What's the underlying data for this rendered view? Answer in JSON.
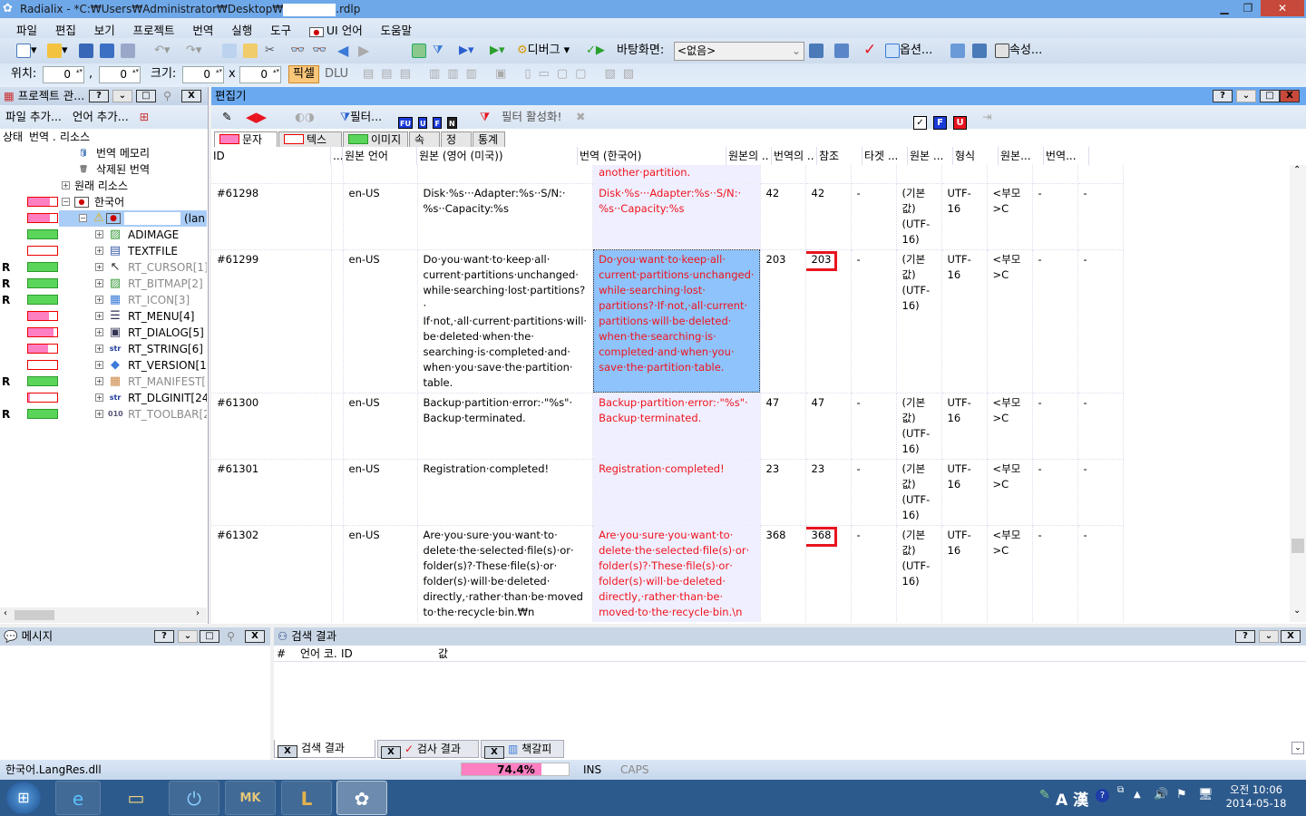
{
  "window": {
    "app_title_prefix": "Radialix - *C:₩Users₩Administrator₩Desktop₩",
    "app_title_suffix": ".rdlp",
    "minimize": "▁",
    "restore": "❐",
    "close": "✕",
    "close_color": "#c7493b"
  },
  "menu": [
    "파일",
    "편집",
    "보기",
    "프로젝트",
    "번역",
    "실행",
    "도구",
    "UI 언어",
    "도움말"
  ],
  "toolbar": {
    "debug_label": "디버그",
    "desktop_label": "바탕화면:",
    "desktop_value": "<없음>",
    "options_label": "옵션...",
    "properties_label": "속성...",
    "position_label": "위치:",
    "pos_x": "0",
    "pos_y": "0",
    "comma": ",",
    "size_label": "크기:",
    "size_w": "0",
    "size_h": "0",
    "times": "x",
    "pixel_label": "픽셀",
    "dlu_label": "DLU"
  },
  "project": {
    "title": "프로젝트 관...",
    "add_file": "파일 추가...",
    "add_language": "언어 추가...",
    "col_status": "상태",
    "col_translation": "번역 .",
    "col_resources": "리소스",
    "tree": [
      {
        "label": "번역 메모리",
        "icon": "database-icon",
        "status": "",
        "bar": "none",
        "fill": 0,
        "grey": false,
        "level": 0,
        "expander": ""
      },
      {
        "label": "삭제된 번역",
        "icon": "trash-icon",
        "status": "",
        "bar": "none",
        "fill": 0,
        "grey": false,
        "level": 0,
        "expander": ""
      },
      {
        "label": "원래 리소스",
        "icon": "",
        "status": "",
        "bar": "none",
        "fill": 0,
        "grey": false,
        "level": -1,
        "expander": "+"
      },
      {
        "label": "한국어",
        "icon": "korea-flag-icon",
        "status": "",
        "bar": "pink",
        "fill": 0.75,
        "grey": false,
        "level": -1,
        "expander": "-"
      },
      {
        "label": "(lan",
        "icon": "warning-flag-icon",
        "status": "",
        "bar": "pink",
        "fill": 0.75,
        "grey": false,
        "level": 1,
        "expander": "-",
        "selected": true
      },
      {
        "label": "ADIMAGE",
        "icon": "image-icon",
        "status": "",
        "bar": "green",
        "fill": 1,
        "grey": false,
        "level": 2,
        "expander": "+"
      },
      {
        "label": "TEXTFILE",
        "icon": "textfile-icon",
        "status": "",
        "bar": "pink",
        "fill": 0,
        "grey": false,
        "level": 2,
        "expander": "+"
      },
      {
        "label": "RT_CURSOR[1]",
        "icon": "cursor-icon",
        "status": "R",
        "bar": "green",
        "fill": 1,
        "grey": true,
        "level": 2,
        "expander": "+"
      },
      {
        "label": "RT_BITMAP[2]",
        "icon": "bitmap-icon",
        "status": "R",
        "bar": "green",
        "fill": 1,
        "grey": true,
        "level": 2,
        "expander": "+"
      },
      {
        "label": "RT_ICON[3]",
        "icon": "icon-resource-icon",
        "status": "R",
        "bar": "green",
        "fill": 1,
        "grey": true,
        "level": 2,
        "expander": "+"
      },
      {
        "label": "RT_MENU[4]",
        "icon": "menu-icon",
        "status": "",
        "bar": "pink",
        "fill": 0.72,
        "grey": false,
        "level": 2,
        "expander": "+"
      },
      {
        "label": "RT_DIALOG[5]",
        "icon": "dialog-icon",
        "status": "",
        "bar": "pink",
        "fill": 0.88,
        "grey": false,
        "level": 2,
        "expander": "+"
      },
      {
        "label": "RT_STRING[6]",
        "icon": "string-icon",
        "status": "",
        "bar": "pink",
        "fill": 0.68,
        "grey": false,
        "level": 2,
        "expander": "+"
      },
      {
        "label": "RT_VERSION[1",
        "icon": "version-icon",
        "status": "",
        "bar": "pink",
        "fill": 0,
        "grey": false,
        "level": 2,
        "expander": "+"
      },
      {
        "label": "RT_MANIFEST[",
        "icon": "manifest-icon",
        "status": "R",
        "bar": "green",
        "fill": 1,
        "grey": true,
        "level": 2,
        "expander": "+"
      },
      {
        "label": "RT_DLGINIT[24",
        "icon": "string-icon",
        "status": "",
        "bar": "pink",
        "fill": 0.05,
        "grey": false,
        "level": 2,
        "expander": "+"
      },
      {
        "label": "RT_TOOLBAR[2",
        "icon": "toolbar-icon",
        "status": "R",
        "bar": "green",
        "fill": 1,
        "grey": true,
        "level": 2,
        "expander": "+"
      }
    ]
  },
  "editor": {
    "title": "편집기",
    "filter_label": "필터...",
    "filter_activate": "필터 활성화!",
    "filter_badges": [
      "FU",
      "U",
      "F",
      "N"
    ],
    "right_badges": [
      "✓",
      "F",
      "U"
    ],
    "tabs": [
      {
        "label": "문자열",
        "swatch": "pink"
      },
      {
        "label": "텍스트",
        "swatch": "outline"
      },
      {
        "label": "이미지",
        "swatch": "green"
      },
      {
        "label": "속성",
        "swatch": ""
      },
      {
        "label": "정보",
        "swatch": ""
      },
      {
        "label": "통계",
        "swatch": ""
      }
    ],
    "columns": [
      "ID",
      "...",
      "원본 언어",
      "원본 (영어 (미국))",
      "번역 (한국어)",
      "원본의 ..",
      "번역의 ..",
      "참조",
      "타겟 ...",
      "원본 ...",
      "형식",
      "원본...",
      "번역..."
    ],
    "rows": [
      {
        "id": "",
        "lang": "",
        "source": "",
        "translation": "another·partition.",
        "src_len": "",
        "tr_len": "",
        "ref": "",
        "target": "",
        "src_enc": "",
        "format": "",
        "c11": "",
        "c12": ""
      },
      {
        "id": "#61298",
        "lang": "en-US",
        "source": "Disk·%s···Adapter:%s··S/N:·\n%s··Capacity:%s",
        "translation": "Disk·%s···Adapter:%s··S/N:·\n%s··Capacity:%s",
        "src_len": "42",
        "tr_len": "42",
        "ref": "-",
        "target": "(기본값)\n(UTF-16)",
        "src_enc": "UTF-16",
        "format": "<부모>C",
        "c11": "-",
        "c12": "-"
      },
      {
        "id": "#61299",
        "lang": "en-US",
        "source": "Do·you·want·to·keep·all·\ncurrent·partitions·unchanged·\nwhile·searching·lost·partitions?·\nIf·not,·all·current·partitions·will·\nbe·deleted·when·the·\nsearching·is·completed·and·\nwhen·you·save·the·partition·\ntable.",
        "translation": "Do·you·want·to·keep·all·\ncurrent·partitions·unchanged·\nwhile·searching·lost·\npartitions?·If·not,·all·current·\npartitions·will·be·deleted·\nwhen·the·searching·is·\ncompleted·and·when·you·\nsave·the·partition·table.",
        "src_len": "203",
        "tr_len": "203",
        "ref": "-",
        "target": "(기본값)\n(UTF-16)",
        "src_enc": "UTF-16",
        "format": "<부모>C",
        "c11": "-",
        "c12": "-",
        "selected": true,
        "flag": true
      },
      {
        "id": "#61300",
        "lang": "en-US",
        "source": "Backup·partition·error:·\"%s\"·\nBackup·terminated.",
        "translation": "Backup·partition·error:·\"%s\"·\nBackup·terminated.",
        "src_len": "47",
        "tr_len": "47",
        "ref": "-",
        "target": "(기본값)\n(UTF-16)",
        "src_enc": "UTF-16",
        "format": "<부모>C",
        "c11": "-",
        "c12": "-"
      },
      {
        "id": "#61301",
        "lang": "en-US",
        "source": "Registration·completed!",
        "translation": "Registration·completed!",
        "src_len": "23",
        "tr_len": "23",
        "ref": "-",
        "target": "(기본값)\n(UTF-16)",
        "src_enc": "UTF-16",
        "format": "<부모>C",
        "c11": "-",
        "c12": "-"
      },
      {
        "id": "#61302",
        "lang": "en-US",
        "source": "Are·you·sure·you·want·to·\ndelete·the·selected·file(s)·or·\nfolder(s)?·These·file(s)·or·\nfolder(s)·will·be·deleted·\ndirectly,·rather·than·be·moved\nto·the·recycle·bin.₩n\nPartitionGuru·will·delete·the·\nfiles·directly·from·the·disk·\nregardless·the·file·access·\nmechanism·of·the·operating·\nsystem.₩n\nImproper·deleting·may·cause·\napplication·error,·or·the·\noperating·system·maybe·\ncrashed.·",
        "translation": "Are·you·sure·you·want·to·\ndelete·the·selected·file(s)·or·\nfolder(s)?·These·file(s)·or·\nfolder(s)·will·be·deleted·\ndirectly,·rather·than·be·\nmoved·to·the·recycle·bin.\\n\nPartitionGuru·will·delete·the·\nfiles·directly·from·the·disk·\nregardless·the·file·access·\nmechanism·of·the·operating·\nsystem.\\n\nImproper·deleting·may·\ncause·application·error,·or·\nthe·operating·system·maybe·",
        "src_len": "368",
        "tr_len": "368",
        "ref": "-",
        "target": "(기본값)\n(UTF-16)",
        "src_enc": "UTF-16",
        "format": "<부모>C",
        "c11": "-",
        "c12": "-",
        "flag": true
      }
    ]
  },
  "messages": {
    "title": "메시지"
  },
  "search": {
    "title": "검색 결과",
    "columns": [
      "#",
      "언어 코.",
      "ID",
      "값"
    ],
    "tabs": [
      "검색 결과",
      "검사 결과",
      "책갈피"
    ]
  },
  "status": {
    "file": "한국어.LangRes.dll",
    "progress_text": "74.4%",
    "progress": 0.744,
    "ins": "INS",
    "caps": "CAPS"
  },
  "taskbar": {
    "ime": "A 漢",
    "time": "오전 10:06",
    "date": "2014-05-18"
  },
  "colors": {
    "accent_blue": "#6aa9ef",
    "translation_red": "#f0141e",
    "progress_pink": "#ff7fc3",
    "done_green": "#5ad55a"
  }
}
